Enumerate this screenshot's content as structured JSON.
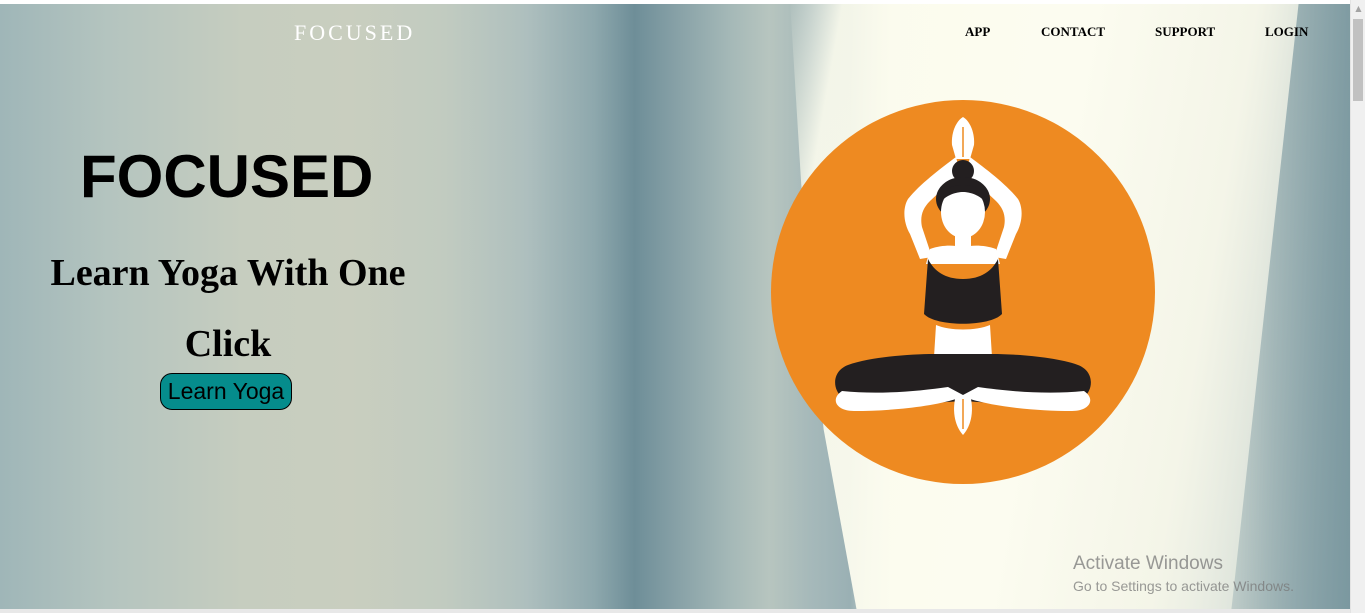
{
  "brand": "FOCUSED",
  "nav": {
    "app": "APP",
    "contact": "CONTACT",
    "support": "SUPPORT",
    "login": "LOGIN"
  },
  "hero": {
    "title": "FOCUSED",
    "subtitle": "Learn Yoga With One Click",
    "button": "Learn Yoga"
  },
  "illustration": {
    "icon": "yoga-meditation-icon",
    "circle_color": "#ee8a21",
    "figure_color": "#231f20"
  },
  "watermark": {
    "line1": "Activate Windows",
    "line2": "Go to Settings to activate Windows."
  },
  "colors": {
    "button_bg": "#058c8c",
    "brand_text": "#ffffff"
  }
}
